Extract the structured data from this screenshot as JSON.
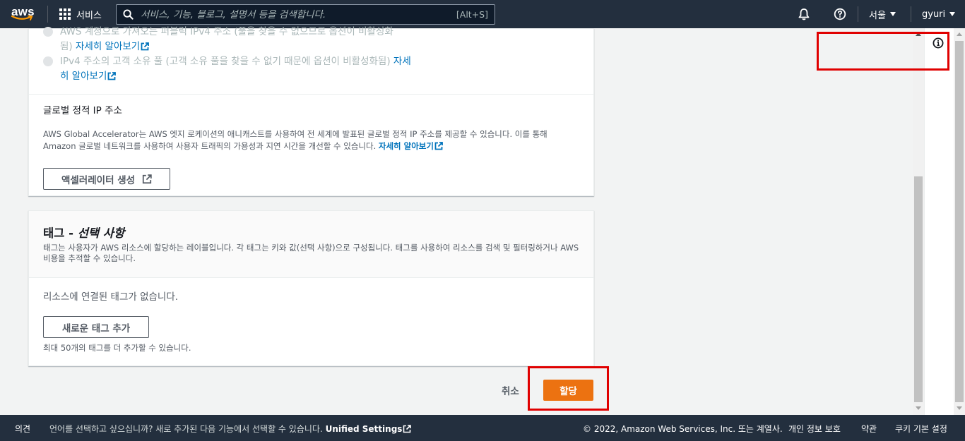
{
  "nav": {
    "logo_text": "aws",
    "services_label": "서비스",
    "search_placeholder": "서비스, 기능, 블로그, 설명서 등을 검색합니다.",
    "search_shortcut": "[Alt+S]",
    "region_label": "서울",
    "user_label": "gyuri"
  },
  "ip_options": {
    "option1_text": "AWS 계정으로 가져오는 퍼블릭 IPv4 주소 (풀을 찾을 수 없으므로 옵션이 비활성화",
    "option1_text2": "됨)",
    "option2_text": "IPv4 주소의 고객 소유 풀 (고객 소유 풀을 찾을 수 없기 때문에 옵션이 비활성화됨)",
    "learn_more_a": "자세히 알아보기",
    "learn_more_b1": "자세",
    "learn_more_b2": "히 알아보기"
  },
  "global_static": {
    "title": "글로벌 정적 IP 주소",
    "description": "AWS Global Accelerator는 AWS 엣지 로케이션의 애니캐스트를 사용하여 전 세계에 발표된 글로벌 정적 IP 주소를 제공할 수 있습니다. 이를 통해 Amazon 글로벌 네트워크를 사용하여 사용자 트래픽의 가용성과 지연 시간을 개선할 수 있습니다.",
    "learn_more": "자세히 알아보기",
    "create_button": "액셀러레이터 생성"
  },
  "tags": {
    "title": "태그 - ",
    "title_optional": "선택 사항",
    "description": "태그는 사용자가 AWS 리소스에 할당하는 레이블입니다. 각 태그는 키와 값(선택 사항)으로 구성됩니다. 태그를 사용하여 리소스를 검색 및 필터링하거나 AWS 비용을 추적할 수 있습니다.",
    "no_tags": "리소스에 연결된 태그가 없습니다.",
    "add_button": "새로운 태그 추가",
    "limit_text": "최대 50개의 태그를 더 추가할 수 있습니다."
  },
  "actions": {
    "cancel": "취소",
    "allocate": "할당"
  },
  "footer": {
    "feedback": "의견",
    "language_prompt": "언어를 선택하고 싶으십니까? 새로 추가된 다음 기능에서 선택할 수 있습니다. ",
    "unified_settings": "Unified Settings",
    "copyright": "© 2022, Amazon Web Services, Inc. 또는 계열사.",
    "privacy": "개인 정보 보호",
    "terms": "약관",
    "cookie": "쿠키 기본 설정"
  },
  "colors": {
    "nav_bg": "#232f3e",
    "primary": "#ec7211",
    "link": "#0073bb",
    "highlight": "#e00000"
  },
  "icons": [
    "aws-logo",
    "grid-icon",
    "search-icon",
    "bell-icon",
    "help-icon",
    "external-link-icon",
    "info-icon"
  ]
}
